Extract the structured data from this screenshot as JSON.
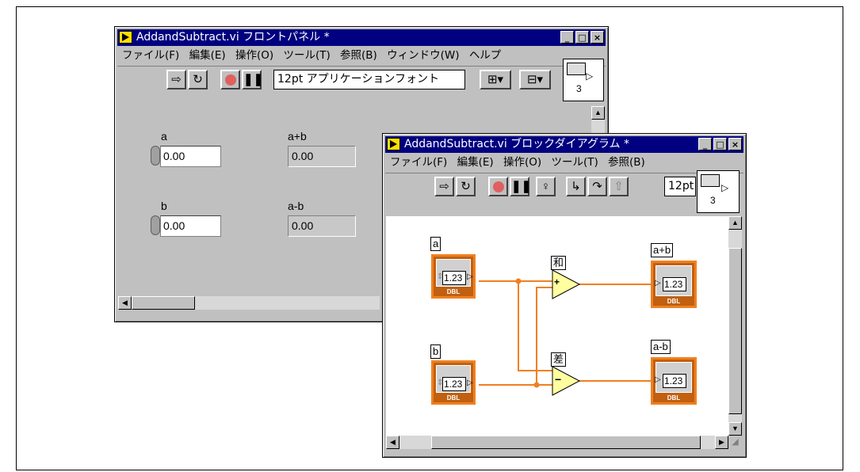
{
  "front_panel": {
    "title": "AddandSubtract.vi フロントパネル *",
    "menu": [
      "ファイル(F)",
      "編集(E)",
      "操作(O)",
      "ツール(T)",
      "参照(B)",
      "ウィンドウ(W)",
      "ヘルプ"
    ],
    "font_select": "12pt アプリケーションフォント",
    "connector_number": "3",
    "controls": [
      {
        "label": "a",
        "value": "0.00"
      },
      {
        "label": "b",
        "value": "0.00"
      }
    ],
    "indicators": [
      {
        "label": "a+b",
        "value": "0.00"
      },
      {
        "label": "a-b",
        "value": "0.00"
      }
    ]
  },
  "block_diagram": {
    "title": "AddandSubtract.vi ブロックダイアグラム *",
    "menu": [
      "ファイル(F)",
      "編集(E)",
      "操作(O)",
      "ツール(T)",
      "参照(B)"
    ],
    "font_select": "12pt",
    "connector_number": "3",
    "inputs": [
      {
        "label": "a",
        "value": "1.23",
        "type": "DBL"
      },
      {
        "label": "b",
        "value": "1.23",
        "type": "DBL"
      }
    ],
    "outputs": [
      {
        "label": "a+b",
        "value": "1.23",
        "type": "DBL"
      },
      {
        "label": "a-b",
        "value": "1.23",
        "type": "DBL"
      }
    ],
    "nodes": [
      {
        "label": "和",
        "symbol": "+"
      },
      {
        "label": "差",
        "symbol": "−"
      }
    ]
  },
  "colors": {
    "title_bar": "#000080",
    "wire": "#f08020",
    "terminal": "#f08020",
    "window": "#c0c0c0"
  }
}
